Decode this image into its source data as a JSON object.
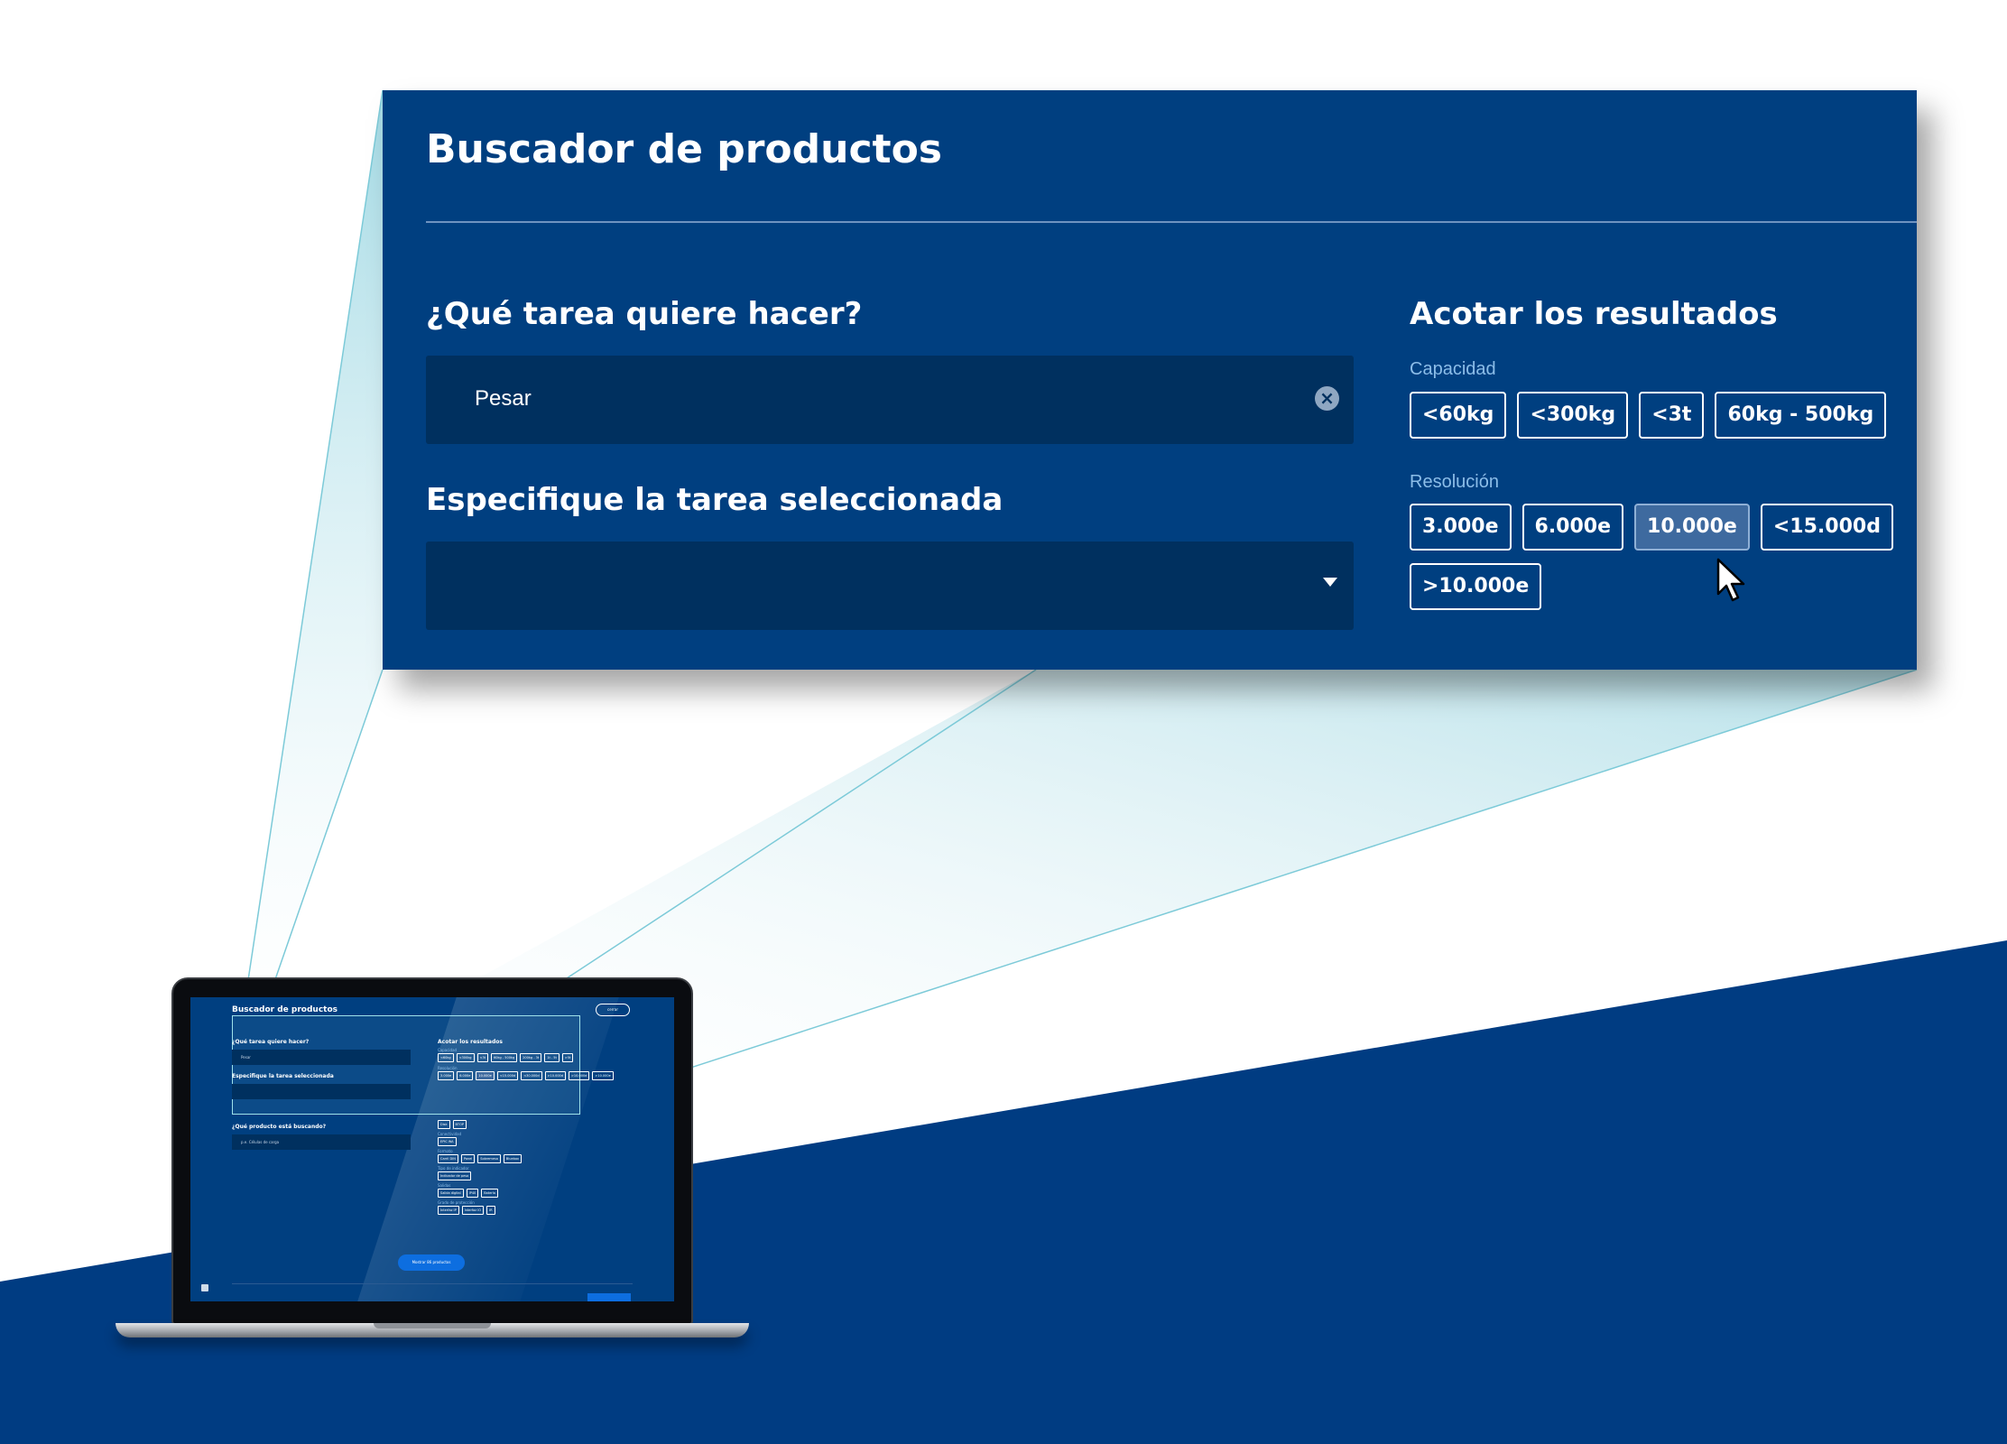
{
  "colors": {
    "panel_bg": "#003f80",
    "field_bg": "#00305f",
    "accent_label": "#8cbde8",
    "chip_active": "#3e6a9f",
    "floor_navy": "#003c82",
    "beam_cyan": "#8fd3e0",
    "mini_cta": "#0d6ee0"
  },
  "zoom": {
    "title": "Buscador de productos",
    "task": {
      "heading": "¿Qué tarea quiere hacer?",
      "value": "Pesar",
      "clear_icon": "clear-circle-icon"
    },
    "specify": {
      "heading": "Especifique la tarea seleccionada",
      "value": "",
      "caret_icon": "caret-down-icon"
    },
    "filters": {
      "heading": "Acotar los resultados",
      "capacity": {
        "label": "Capacidad",
        "options": [
          "<60kg",
          "<300kg",
          "<3t",
          "60kg - 500kg"
        ]
      },
      "resolution": {
        "label": "Resolución",
        "options": [
          "3.000e",
          "6.000e",
          "10.000e",
          "<15.000d",
          ">10.000e"
        ],
        "selected": "10.000e"
      }
    },
    "cursor_icon": "mouse-pointer-icon"
  },
  "laptop": {
    "title": "Buscador de productos",
    "close_label": "cerrar",
    "task_heading": "¿Qué tarea quiere hacer?",
    "task_value": "Pesar",
    "specify_heading": "Especifique la tarea seleccionada",
    "product_heading": "¿Qué producto está buscando?",
    "product_value": "p.e. Células de carga",
    "filters_heading": "Acotar los resultados",
    "capacity_label": "Capacidad",
    "capacity_options": [
      "<60kg",
      "<300kg",
      "<3t",
      "60kg - 500kg",
      "200kg - 3t",
      "1t - 5t",
      ">5t"
    ],
    "resolution_label": "Resolución",
    "resolution_options": [
      "3.000e",
      "6.000e",
      "10.000e",
      "<15.000d",
      "<30.000d",
      ">10.000d",
      ">10.000d",
      ">10.000e"
    ],
    "type_options": [
      "Disk",
      "BTOP"
    ],
    "connectivity_label": "Conectividad",
    "connectivity_options": [
      "EPIC WA"
    ],
    "format_label": "Formato",
    "format_options": [
      "Carril DIN",
      "Panel",
      "Sobremesa",
      "Bluebox"
    ],
    "display_label": "Tipo de indicador",
    "display_options": [
      "Indicador de peso"
    ],
    "output_label": "Salidas",
    "output_options": [
      "Salida digital",
      "IP40",
      "Batería"
    ],
    "protection_label": "Grado de protección",
    "protection_options": [
      "Interfaz IP",
      "Interfaz IO",
      "IR"
    ],
    "cta_label": "Mostrar 86 productos"
  }
}
